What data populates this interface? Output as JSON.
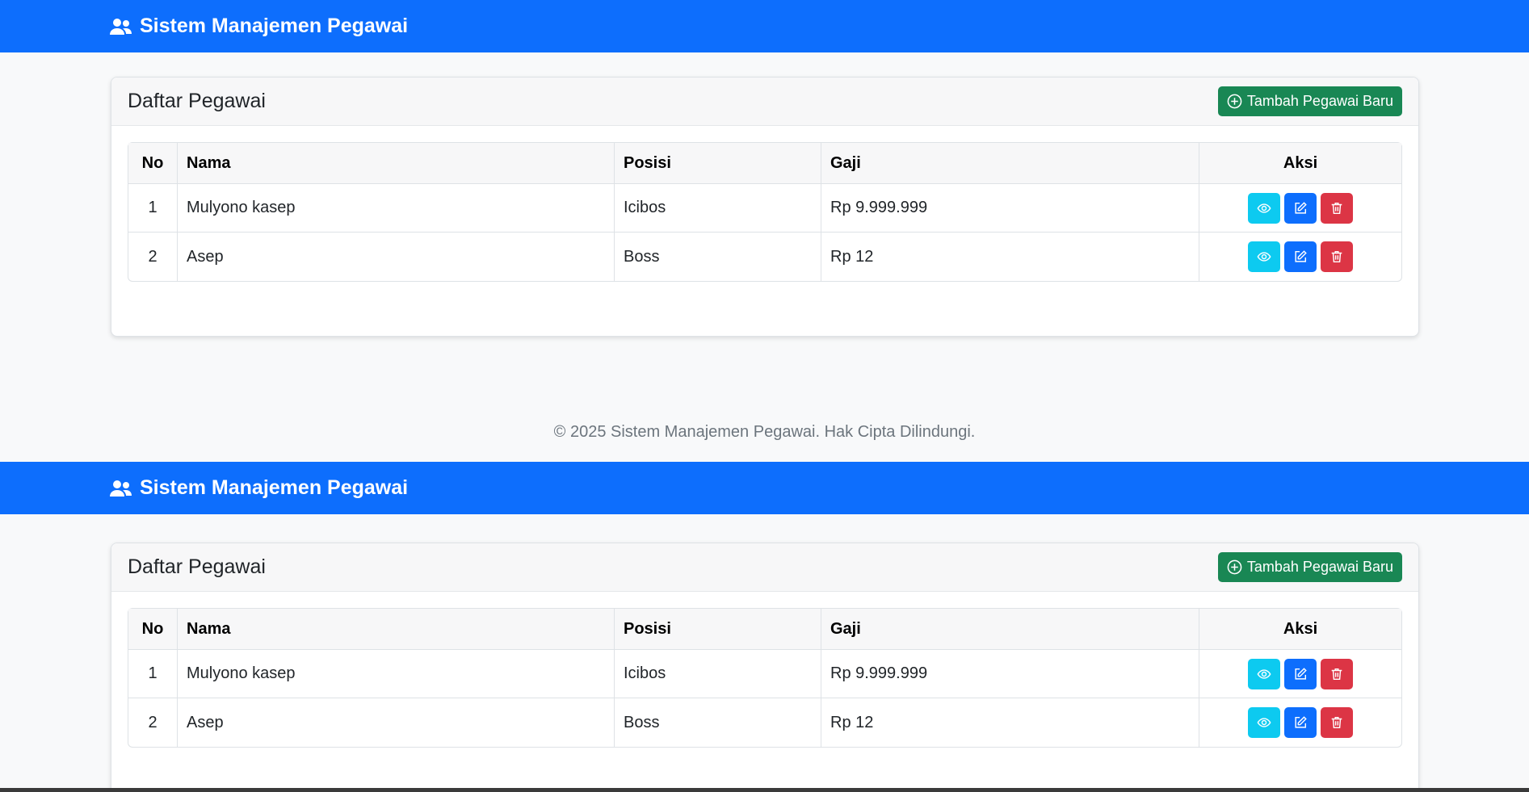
{
  "app": {
    "brand": "Sistem Manajemen Pegawai",
    "brand_icon": "users-icon"
  },
  "card": {
    "title": "Daftar Pegawai",
    "add_button_label": "Tambah Pegawai Baru",
    "add_button_icon": "plus-circle-icon"
  },
  "table": {
    "headers": {
      "no": "No",
      "nama": "Nama",
      "posisi": "Posisi",
      "gaji": "Gaji",
      "aksi": "Aksi"
    },
    "rows": [
      {
        "no": "1",
        "nama": "Mulyono kasep",
        "posisi": "Icibos",
        "gaji": "Rp 9.999.999"
      },
      {
        "no": "2",
        "nama": "Asep",
        "posisi": "Boss",
        "gaji": "Rp 12"
      }
    ]
  },
  "footer": {
    "text": "© 2025 Sistem Manajemen Pegawai. Hak Cipta Dilindungi."
  },
  "colors": {
    "primary": "#0d6efd",
    "success": "#198754",
    "info": "#0dcaf0",
    "danger": "#dc3545"
  }
}
